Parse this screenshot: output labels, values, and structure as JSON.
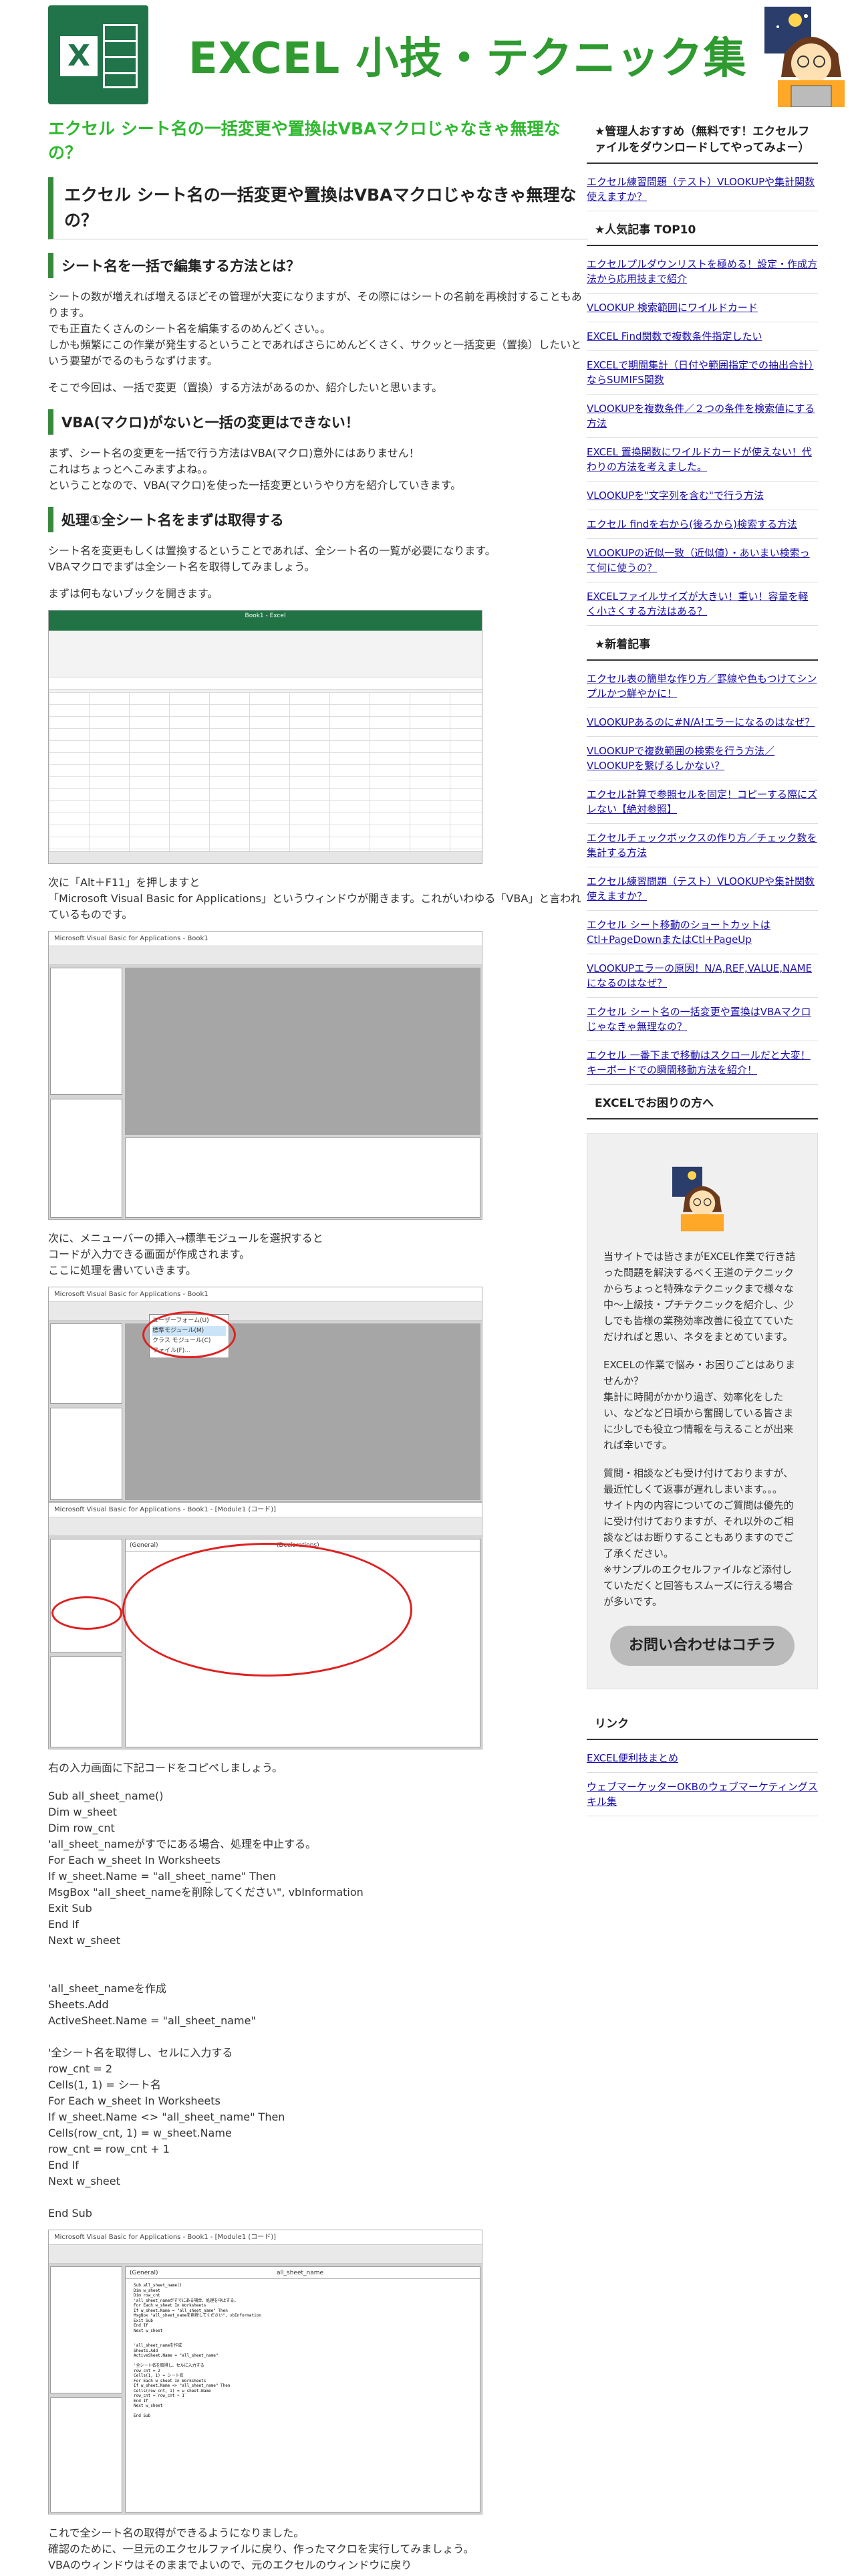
{
  "header": {
    "site_title": "EXCEL 小技・テクニック集"
  },
  "article": {
    "headline": "エクセル シート名の一括変更や置換はVBAマクロじゃなきゃ無理なの？",
    "h2_title": "エクセル シート名の一括変更や置換はVBAマクロじゃなきゃ無理なの？",
    "s1_title": "シート名を一括で編集する方法とは？",
    "s1_p1": "シートの数が増えれば増えるほどその管理が大変になりますが、その際にはシートの名前を再検討することもあります。\nでも正直たくさんのシート名を編集するのめんどくさい。。\nしかも頻繁にこの作業が発生するということであればさらにめんどくさく、サクッと一括変更（置換）したいという要望がでるのもうなずけます。",
    "s1_p2": "そこで今回は、一括で変更（置換）する方法があるのか、紹介したいと思います。",
    "s2_title": "VBA(マクロ)がないと一括の変更はできない！",
    "s2_p1": "まず、シート名の変更を一括で行う方法はVBA(マクロ)意外にはありません！\nこれはちょっとへこみますよね。。\nということなので、VBA(マクロ)を使った一括変更というやり方を紹介していきます。",
    "s3_title": "処理①全シート名をまずは取得する",
    "s3_p1": "シート名を変更もしくは置換するということであれば、全シート名の一覧が必要になります。\nVBAマクロでまずは全シート名を取得してみましょう。",
    "s3_p2": "まずは何もないブックを開きます。",
    "s3_p3": "次に「Alt＋F11」を押しますと\n「Microsoft Visual Basic for Applications」というウィンドウが開きます。これがいわゆる「VBA」と言われているものです。",
    "s3_p4": "次に、メニューバーの挿入→標準モジュールを選択すると\nコードが入力できる画面が作成されます。\nここに処理を書いていきます。",
    "s3_p5": "右の入力画面に下記コードをコピペしましょう。",
    "code": "Sub all_sheet_name()\nDim w_sheet\nDim row_cnt\n'all_sheet_nameがすでにある場合、処理を中止する。\nFor Each w_sheet In Worksheets\nIf w_sheet.Name = \"all_sheet_name\" Then\nMsgBox \"all_sheet_nameを削除してください\", vbInformation\nExit Sub\nEnd If\nNext w_sheet\n\n\n'all_sheet_nameを作成\nSheets.Add\nActiveSheet.Name = \"all_sheet_name\"\n\n'全シート名を取得し、セルに入力する\nrow_cnt = 2\nCells(1, 1) = シート名\nFor Each w_sheet In Worksheets\nIf w_sheet.Name <> \"all_sheet_name\" Then\nCells(row_cnt, 1) = w_sheet.Name\nrow_cnt = row_cnt + 1\nEnd If\nNext w_sheet\n\nEnd Sub",
    "s3_p6": "これで全シート名の取得ができるようになりました。\n確認のために、一旦元のエクセルファイルに戻り、作ったマクロを実行してみましょう。\nVBAのウィンドウはそのままでよいので、元のエクセルのウィンドウに戻り\nメニューバーから\n表示→マクロ→マクロの表示"
  },
  "screens": {
    "excel_title": "Book1 - Excel",
    "vbe_title": "Microsoft Visual Basic for Applications - Book1",
    "vbe_title2": "Microsoft Visual Basic for Applications - Book1 - [Module1 (コード)]",
    "general": "(General)",
    "declarations": "(Declarations)",
    "all_sheet_name": "all_sheet_name",
    "insert_menu": "挿入(I)",
    "menu_std_module": "標準モジュール(M)",
    "menu_user_form": "ユーザーフォーム(U)",
    "menu_class": "クラス モジュール(C)",
    "menu_file": "ファイル(F)..."
  },
  "sidebar": {
    "recommend_title": "★管理人おすすめ（無料です！エクセルファイルをダウンロードしてやってみよー）",
    "recommend_links": [
      "エクセル練習問題（テスト）VLOOKUPや集計関数使えますか？"
    ],
    "popular_title": "★人気記事 TOP10",
    "popular_links": [
      "エクセルプルダウンリストを極める！設定・作成方法から応用技まで紹介",
      "VLOOKUP 検索範囲にワイルドカード",
      "EXCEL Find関数で複数条件指定したい",
      "EXCELで期間集計（日付や範囲指定での抽出合計）ならSUMIFS関数",
      "VLOOKUPを複数条件／２つの条件を検索値にする方法",
      "EXCEL 置換関数にワイルドカードが使えない！代わりの方法を考えました。",
      "VLOOKUPを\"文字列を含む\"で行う方法",
      "エクセル findを右から(後ろから)検索する方法",
      "VLOOKUPの近似一致（近似値）・あいまい検索って何に使うの？",
      "EXCELファイルサイズが大きい！重い！容量を軽く小さくする方法はある？"
    ],
    "new_title": "★新着記事",
    "new_links": [
      "エクセル表の簡単な作り方／罫線や色もつけてシンプルかつ鮮やかに！",
      "VLOOKUPあるのに#N/A!エラーになるのはなぜ？",
      "VLOOKUPで複数範囲の検索を行う方法／VLOOKUPを繋げるしかない？",
      "エクセル計算で参照セルを固定！コピーする際にズレない【絶対参照】",
      "エクセルチェックボックスの作り方／チェック数を集計する方法",
      "エクセル練習問題（テスト）VLOOKUPや集計関数使えますか？",
      "エクセル シート移動のショートカットはCtl+PageDownまたはCtl+PageUp",
      "VLOOKUPエラーの原因！N/A,REF,VALUE,NAMEになるのはなぜ？",
      "エクセル シート名の一括変更や置換はVBAマクロじゃなきゃ無理なの？",
      "エクセル 一番下まで移動はスクロールだと大変！キーボードでの瞬間移動方法を紹介！"
    ],
    "help_title": "EXCELでお困りの方へ",
    "profile_p1": "当サイトでは皆さまがEXCEL作業で行き詰った問題を解決するべく王道のテクニックからちょっと特殊なテクニックまで様々な中〜上級技・プチテクニックを紹介し、少しでも皆様の業務効率改善に役立てていただければと思い、ネタをまとめています。",
    "profile_p2": "EXCELの作業で悩み・お困りごとはありませんか？\n集計に時間がかかり過ぎ、効率化をしたい、などなど日頃から奮闘している皆さまに少しでも役立つ情報を与えることが出来れば幸いです。",
    "profile_p3": "質問・相談なども受け付けておりますが、最近忙しくて返事が遅れしまいます。。。\nサイト内の内容についてのご質問は優先的に受け付けておりますが、それ以外のご相談などはお断りすることもありますのでご了承ください。\n※サンプルのエクセルファイルなど添付していただくと回答もスムーズに行える場合が多いです。",
    "contact_button": "お問い合わせはコチラ",
    "links_title": "リンク",
    "links": [
      "EXCEL便利技まとめ",
      "ウェブマーケッターOKBのウェブマーケティングスキル集"
    ]
  },
  "colors": {
    "accent_green": "#2eb82e",
    "excel_green": "#217346",
    "link": "#1a0dab",
    "bar_green": "#3a8a3e"
  }
}
